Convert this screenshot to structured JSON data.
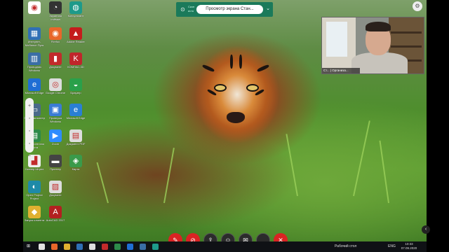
{
  "share_banner": {
    "stop_label": "⊙",
    "small_text": "Скон исто",
    "pill_label": "Просмотр экрана Стан...",
    "chevron": "⌄"
  },
  "video_tile": {
    "name": "Ст... | Организа..."
  },
  "settings_icon": "⚙",
  "desktop_icons": [
    {
      "label": "",
      "color": "#ffffff",
      "glyph": "◉"
    },
    {
      "label": "Интернет-Мобильн Пуск",
      "color": "#2f6fb5",
      "glyph": "▦"
    },
    {
      "label": "Проводник Windows",
      "color": "#3a6ea5",
      "glyph": "▥"
    },
    {
      "label": "Microsoft Edge",
      "color": "#1f6ed4",
      "glyph": "e"
    },
    {
      "label": "Этот компьютер",
      "color": "#4a6a8a",
      "glyph": "▭"
    },
    {
      "label": "Электронн ная почта",
      "color": "#2d8a4a",
      "glyph": "▤"
    },
    {
      "label": "Сканер Штрих",
      "color": "#eeeeee",
      "glyph": "▟"
    },
    {
      "label": "Open Project Project",
      "color": "#1e8aa8",
      "glyph": "◐"
    },
    {
      "label": "Запуск клиента",
      "color": "#e0b030",
      "glyph": "◆"
    },
    {
      "label": "Экранная съёмка",
      "color": "#333333",
      "glyph": "◔"
    },
    {
      "label": "Firefox",
      "color": "#e8672a",
      "glyph": "◉"
    },
    {
      "label": "Документ",
      "color": "#c22b2b",
      "glyph": "▮"
    },
    {
      "label": "Google Chrome",
      "color": "#dddddd",
      "glyph": "◎"
    },
    {
      "label": "Проверка Windows",
      "color": "#3a7bd5",
      "glyph": "▣"
    },
    {
      "label": "Zoom",
      "color": "#2d8cff",
      "glyph": "▶"
    },
    {
      "label": "Принтер",
      "color": "#444444",
      "glyph": "▬"
    },
    {
      "label": "Документ",
      "color": "#dddddd",
      "glyph": "▨"
    },
    {
      "label": "AutoCAD 2017",
      "color": "#b32020",
      "glyph": "A"
    },
    {
      "label": "Консультант",
      "color": "#1e9a8a",
      "glyph": "◍"
    },
    {
      "label": "Adobe Reader",
      "color": "#c41c1c",
      "glyph": "▲"
    },
    {
      "label": "КОМПАС-3D",
      "color": "#c0252b",
      "glyph": "K"
    },
    {
      "label": "Браузер",
      "color": "#2aa04a",
      "glyph": "◒"
    },
    {
      "label": "Microsoft Edge",
      "color": "#2a7fd4",
      "glyph": "e"
    },
    {
      "label": "Документ PDF",
      "color": "#dddddd",
      "glyph": "▤"
    },
    {
      "label": "Карта",
      "color": "#3a9a4a",
      "glyph": "◈"
    }
  ],
  "zoom_tools": [
    "+",
    "◦",
    "◦",
    "◦",
    "−"
  ],
  "call_controls": {
    "mute": "✎",
    "video_off": "⊘",
    "share": "⇪",
    "participants": "☺",
    "chat": "✉",
    "more": "…",
    "hangup": "✕"
  },
  "taskbar": {
    "start": "⊞",
    "desktop_label": "Рабочий стол",
    "lang": "ENG",
    "time": "10:33",
    "date": "07.09.2020"
  }
}
